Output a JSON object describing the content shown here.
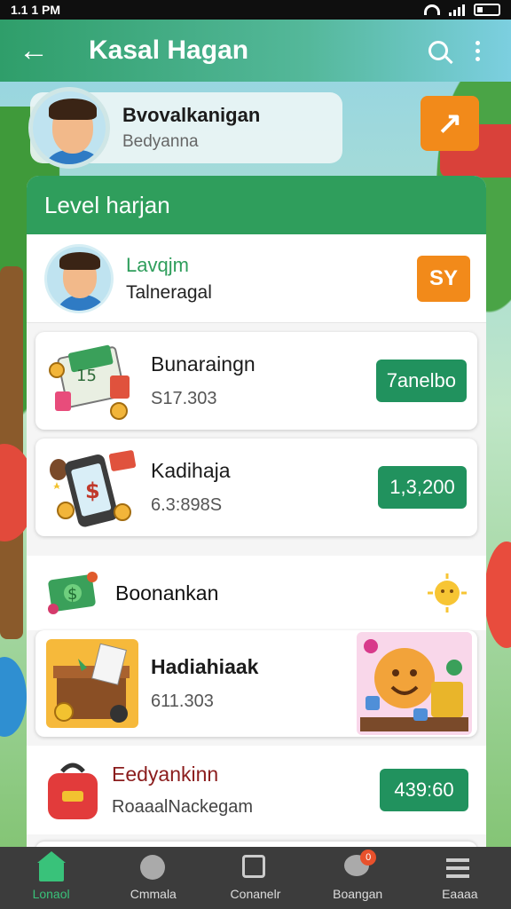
{
  "status_bar": {
    "time": "1.1 1 PM"
  },
  "app_bar": {
    "title": "Kasal Hagan"
  },
  "profile": {
    "name": "Bvovalkanigan",
    "subtitle": "Bedyanna",
    "action": "↗"
  },
  "panel": {
    "header": "Level harjan",
    "level": {
      "title": "Lavqjm",
      "subtitle": "Talneragal",
      "badge": "SY"
    },
    "items": [
      {
        "title": "Bunaraingn",
        "subtitle": "S17.303",
        "button": "7anelbo",
        "icon": "money-stack-icon"
      },
      {
        "title": "Kadihaja",
        "subtitle": "6.3:898S",
        "button": "1,3,200",
        "icon": "phone-dollar-icon"
      }
    ],
    "section": {
      "title": "Boonankan",
      "icon": "cash-icon",
      "extra_icon": "sun-coin-icon"
    },
    "reward": {
      "title": "Hadiahiaak",
      "subtitle": "611.303",
      "icon": "gift-box-icon",
      "art": "smiley-coins-icon"
    },
    "offer": {
      "title": "Eedyankinn",
      "subtitle": "RoaaalNackegam",
      "button": "439:60",
      "icon": "red-bag-icon"
    }
  },
  "nav": [
    {
      "label": "Lonaol",
      "icon": "home-icon",
      "active": true
    },
    {
      "label": "Cmmala",
      "icon": "lock-icon",
      "active": false
    },
    {
      "label": "Conanelr",
      "icon": "house-outline-icon",
      "active": false
    },
    {
      "label": "Boangan",
      "icon": "chat-icon",
      "badge": "0",
      "active": false
    },
    {
      "label": "Eaaaa",
      "icon": "menu-icon",
      "active": false
    }
  ],
  "colors": {
    "primary": "#2f9e5c",
    "accent": "#f28a1a",
    "button": "#21925e",
    "offer_title": "#8b1d1d"
  }
}
